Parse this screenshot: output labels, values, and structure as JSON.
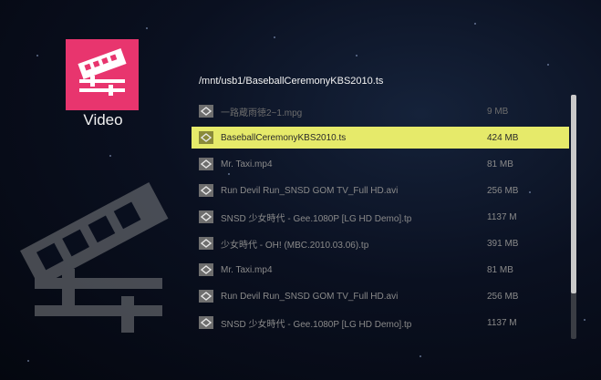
{
  "app": {
    "label": "Video",
    "accent_color": "#e8356e",
    "icon": "film-editor-icon"
  },
  "current_path": "/mnt/usb1/BaseballCeremonyKBS2010.ts",
  "files": [
    {
      "name": "一路蔵雨徳2~1.mpg",
      "size": "9  MB",
      "selected": false,
      "dim": true
    },
    {
      "name": "BaseballCeremonyKBS2010.ts",
      "size": "424  MB",
      "selected": true,
      "dim": false
    },
    {
      "name": "Mr. Taxi.mp4",
      "size": "81  MB",
      "selected": false,
      "dim": false
    },
    {
      "name": "Run Devil Run_SNSD GOM TV_Full HD.avi",
      "size": "256  MB",
      "selected": false,
      "dim": false
    },
    {
      "name": "SNSD 少女時代 - Gee.1080P [LG HD Demo].tp",
      "size": "1137  M",
      "selected": false,
      "dim": false
    },
    {
      "name": "少女時代 - OH! (MBC.2010.03.06).tp",
      "size": "391  MB",
      "selected": false,
      "dim": false
    },
    {
      "name": "Mr. Taxi.mp4",
      "size": "81  MB",
      "selected": false,
      "dim": false
    },
    {
      "name": "Run Devil Run_SNSD GOM TV_Full HD.avi",
      "size": "256  MB",
      "selected": false,
      "dim": false
    },
    {
      "name": "SNSD 少女時代 - Gee.1080P [LG HD Demo].tp",
      "size": "1137  M",
      "selected": false,
      "dim": false
    }
  ],
  "file_icon": "video-file-icon",
  "highlight_color": "#e6ea6a",
  "scroll_position": 0
}
